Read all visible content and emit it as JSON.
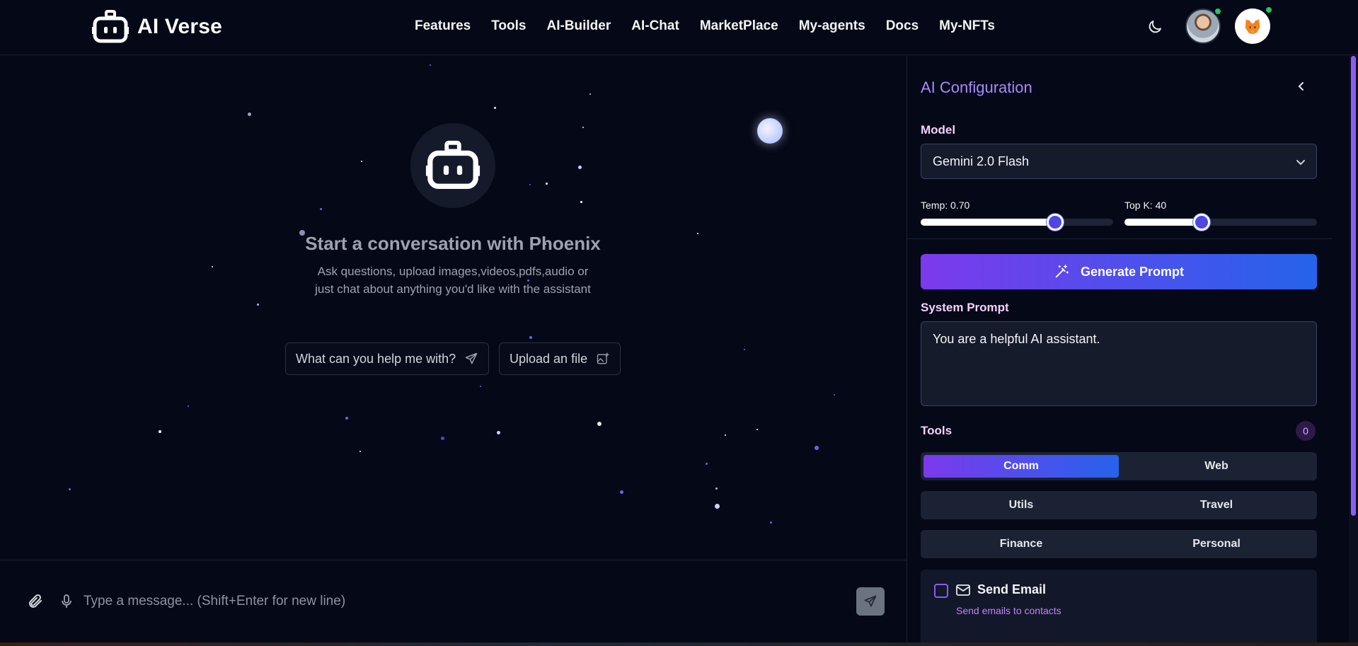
{
  "app": {
    "name": "AI Verse"
  },
  "nav": {
    "items": [
      "Features",
      "Tools",
      "AI-Builder",
      "AI-Chat",
      "MarketPlace",
      "My-agents",
      "Docs",
      "My-NFTs"
    ]
  },
  "hero": {
    "title": "Start a conversation with Phoenix",
    "subtitle": "Ask questions, upload images,videos,pdfs,audio or just chat about anything you'd like with the assistant",
    "chip_help": "What can you help me with?",
    "chip_upload": "Upload an file"
  },
  "composer": {
    "placeholder": "Type a message... (Shift+Enter for new line)"
  },
  "config": {
    "title": "AI Configuration",
    "model_label": "Model",
    "model_value": "Gemini 2.0 Flash",
    "temp_label": "Temp: 0.70",
    "temp_value": 0.7,
    "topk_label": "Top K: 40",
    "topk_fraction": 0.4,
    "generate_label": "Generate Prompt",
    "system_prompt_label": "System Prompt",
    "system_prompt_value": "You are a helpful AI assistant.",
    "tools_label": "Tools",
    "tools_count": "0",
    "tool_tabs": {
      "row1": [
        "Comm",
        "Web"
      ],
      "row2": [
        "Utils",
        "Travel"
      ],
      "row3": [
        "Finance",
        "Personal"
      ]
    },
    "active_tab": "Comm",
    "tool_item": {
      "name": "Send Email",
      "description": "Send emails to contacts"
    }
  },
  "colors": {
    "accent": "#8b5cf6",
    "gradient_start": "#7c3aed",
    "gradient_end": "#2563eb",
    "background": "#050816"
  },
  "icons": [
    "robot-icon",
    "moon-icon",
    "send-icon",
    "image-upload-icon",
    "paperclip-icon",
    "mic-icon",
    "chevron-left-icon",
    "chevron-down-icon",
    "magic-wand-icon",
    "mail-icon",
    "metamask-fox-icon"
  ]
}
